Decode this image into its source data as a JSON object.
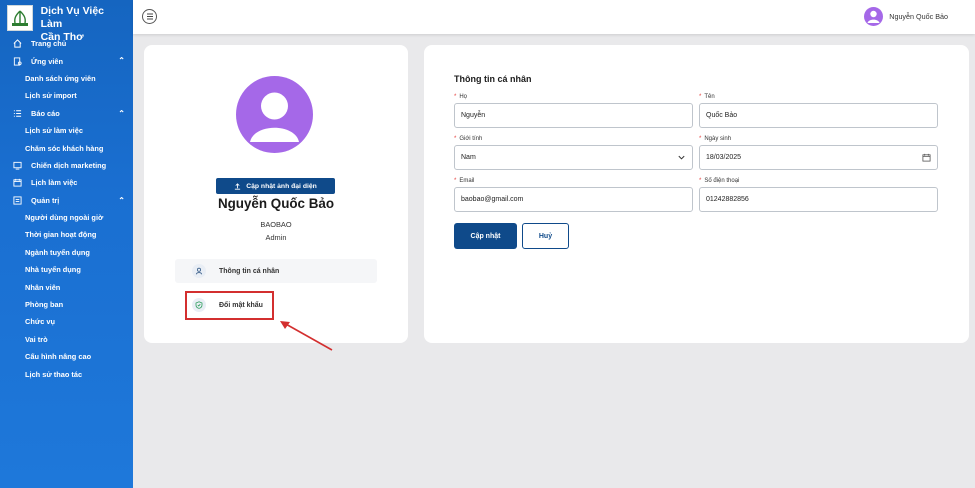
{
  "brand": {
    "line1": "Dịch Vụ Việc Làm",
    "line2": "Cần Thơ"
  },
  "sidebar": {
    "items": [
      {
        "label": "Trang chủ",
        "icon": "home-icon",
        "level": "top"
      },
      {
        "label": "Ứng viên",
        "icon": "candidate-icon",
        "level": "group"
      },
      {
        "label": "Danh sách ứng viên",
        "level": "sub"
      },
      {
        "label": "Lịch sử import",
        "level": "sub"
      },
      {
        "label": "Báo cáo",
        "icon": "list-icon",
        "level": "group"
      },
      {
        "label": "Lịch sử làm việc",
        "level": "sub"
      },
      {
        "label": "Chăm sóc khách hàng",
        "level": "sub"
      },
      {
        "label": "Chiến dịch marketing",
        "icon": "campaign-icon",
        "level": "top"
      },
      {
        "label": "Lịch làm việc",
        "icon": "calendar-icon",
        "level": "top"
      },
      {
        "label": "Quản trị",
        "icon": "admin-icon",
        "level": "group"
      },
      {
        "label": "Người dùng ngoài giờ",
        "level": "sub"
      },
      {
        "label": "Thời gian hoạt động",
        "level": "sub"
      },
      {
        "label": "Ngành tuyển dụng",
        "level": "sub"
      },
      {
        "label": "Nhà tuyển dụng",
        "level": "sub"
      },
      {
        "label": "Nhân viên",
        "level": "sub"
      },
      {
        "label": "Phòng ban",
        "level": "sub"
      },
      {
        "label": "Chức vụ",
        "level": "sub"
      },
      {
        "label": "Vai trò",
        "level": "sub"
      },
      {
        "label": "Cấu hình nâng cao",
        "level": "sub"
      },
      {
        "label": "Lịch sử thao tác",
        "level": "sub"
      }
    ]
  },
  "topbar": {
    "user_name": "Nguyễn Quốc Bảo"
  },
  "profile": {
    "upload_label": "Cập nhật ảnh đại diện",
    "full_name": "Nguyễn Quốc Bảo",
    "username": "BAOBAO",
    "role": "Admin",
    "menu": {
      "info": "Thông tin cá nhân",
      "password": "Đổi mật khẩu"
    }
  },
  "form": {
    "title": "Thông tin cá nhân",
    "last_name": {
      "label": "Họ",
      "value": "Nguyễn"
    },
    "first_name": {
      "label": "Tên",
      "value": "Quốc Bảo"
    },
    "gender": {
      "label": "Giới tính",
      "value": "Nam"
    },
    "birthday": {
      "label": "Ngày sinh",
      "value": "18/03/2025"
    },
    "email": {
      "label": "Email",
      "value": "baobao@gmail.com"
    },
    "phone": {
      "label": "Số điện thoại",
      "value": "01242882856"
    },
    "submit_label": "Cập nhật",
    "cancel_label": "Huỷ"
  },
  "colors": {
    "primary": "#0f4a8a",
    "sidebar": "#1565c0",
    "avatar": "#a568e8",
    "highlight": "#d32f2f"
  }
}
